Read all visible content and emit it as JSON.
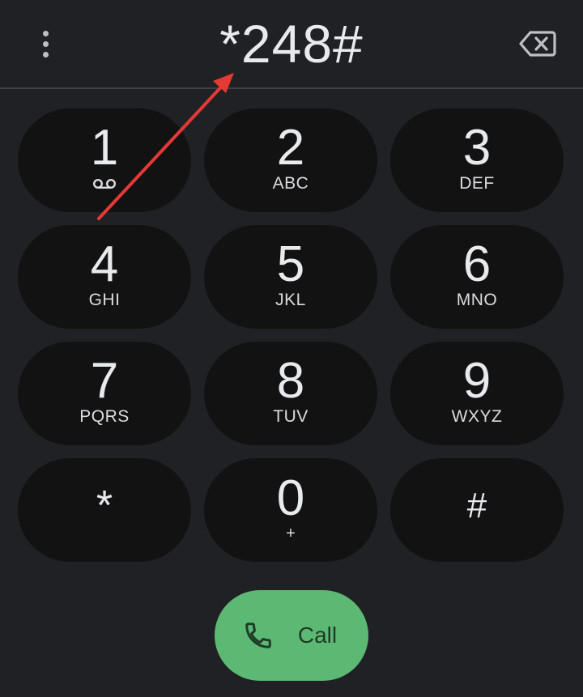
{
  "header": {
    "dialed_number": "*248#",
    "more_options_icon": "more-vert-icon",
    "backspace_icon": "backspace-icon"
  },
  "keypad": {
    "keys": [
      {
        "digit": "1",
        "letters": "",
        "icon": "voicemail-icon"
      },
      {
        "digit": "2",
        "letters": "ABC"
      },
      {
        "digit": "3",
        "letters": "DEF"
      },
      {
        "digit": "4",
        "letters": "GHI"
      },
      {
        "digit": "5",
        "letters": "JKL"
      },
      {
        "digit": "6",
        "letters": "MNO"
      },
      {
        "digit": "7",
        "letters": "PQRS"
      },
      {
        "digit": "8",
        "letters": "TUV"
      },
      {
        "digit": "9",
        "letters": "WXYZ"
      },
      {
        "digit": "*",
        "letters": ""
      },
      {
        "digit": "0",
        "letters": "+"
      },
      {
        "digit": "#",
        "letters": ""
      }
    ]
  },
  "call_button": {
    "label": "Call",
    "icon": "phone-icon"
  },
  "colors": {
    "background": "#202124",
    "key_background": "#121212",
    "call_button": "#5bb974",
    "annotation_arrow": "#e53935"
  }
}
